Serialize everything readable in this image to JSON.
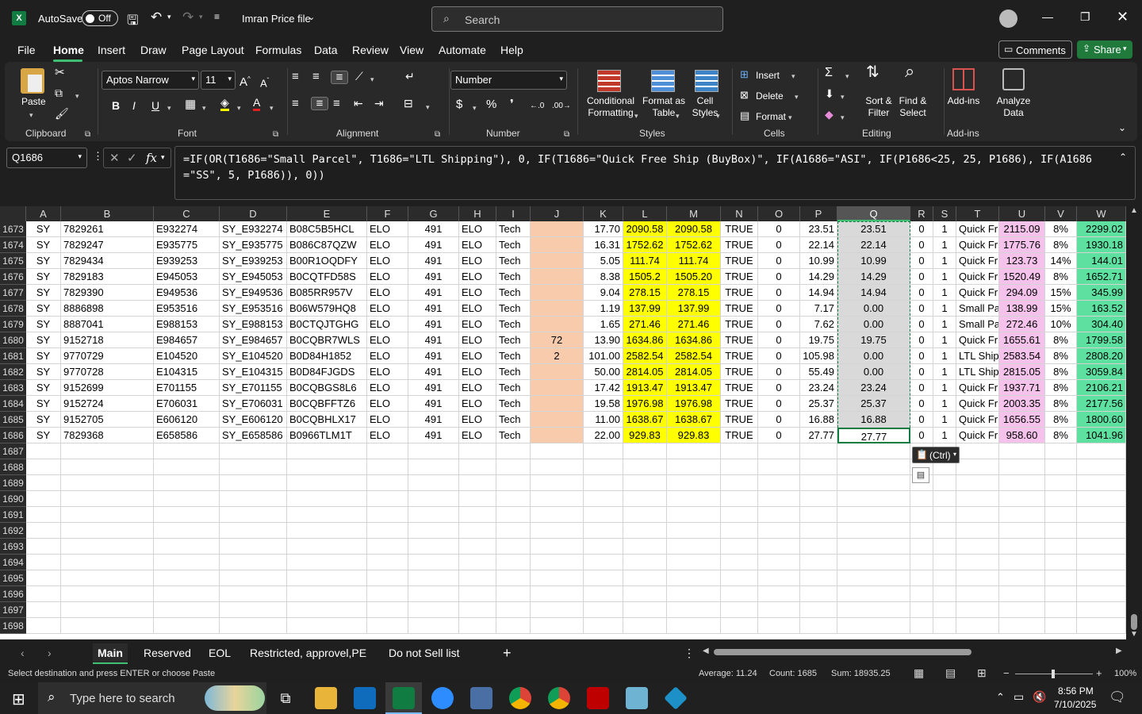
{
  "titlebar": {
    "autosave_label": "AutoSave",
    "autosave_state": "Off",
    "file_name": "Imran Price file",
    "search_placeholder": "Search"
  },
  "menu": [
    "File",
    "Home",
    "Insert",
    "Draw",
    "Page Layout",
    "Formulas",
    "Data",
    "Review",
    "View",
    "Automate",
    "Help"
  ],
  "comments_label": "Comments",
  "share_label": "Share",
  "ribbon": {
    "paste": "Paste",
    "clipboard": "Clipboard",
    "font_name": "Aptos Narrow",
    "font_size": "11",
    "font": "Font",
    "alignment": "Alignment",
    "number_format": "Number",
    "number": "Number",
    "cond_fmt": "Conditional Formatting",
    "fmt_table": "Format as Table",
    "cell_styles": "Cell Styles",
    "styles": "Styles",
    "insert": "Insert",
    "delete": "Delete",
    "format": "Format",
    "cells": "Cells",
    "sort_filter": "Sort & Filter",
    "find_select": "Find & Select",
    "editing": "Editing",
    "addins": "Add-ins",
    "analyze": "Analyze Data",
    "addins_grp": "Add-ins"
  },
  "namebox": "Q1686",
  "formula": "=IF(OR(T1686=\"Small Parcel\", T1686=\"LTL Shipping\"), 0, IF(T1686=\"Quick Free Ship (BuyBox)\", IF(A1686=\"ASI\", IF(P1686<25, 25, P1686), IF(A1686=\"SS\", 5, P1686)), 0))",
  "columns": [
    "A",
    "B",
    "C",
    "D",
    "E",
    "F",
    "G",
    "H",
    "I",
    "J",
    "K",
    "L",
    "M",
    "N",
    "O",
    "P",
    "Q",
    "R",
    "S",
    "T",
    "U",
    "V",
    "W"
  ],
  "rows": [
    {
      "n": "1673",
      "c": [
        "SY",
        "7829261",
        "E932274",
        "SY_E932274",
        "B08C5B5HCL",
        "ELO",
        "491",
        "ELO",
        "Tech",
        "",
        "17.70",
        "2090.58",
        "2090.58",
        "TRUE",
        "0",
        "23.51",
        "23.51",
        "0",
        "1",
        "Quick Fr",
        "2115.09",
        "8%",
        "2299.02"
      ]
    },
    {
      "n": "1674",
      "c": [
        "SY",
        "7829247",
        "E935775",
        "SY_E935775",
        "B086C87QZW",
        "ELO",
        "491",
        "ELO",
        "Tech",
        "",
        "16.31",
        "1752.62",
        "1752.62",
        "TRUE",
        "0",
        "22.14",
        "22.14",
        "0",
        "1",
        "Quick Fr",
        "1775.76",
        "8%",
        "1930.18"
      ]
    },
    {
      "n": "1675",
      "c": [
        "SY",
        "7829434",
        "E939253",
        "SY_E939253",
        "B00R1OQDFY",
        "ELO",
        "491",
        "ELO",
        "Tech",
        "",
        "5.05",
        "111.74",
        "111.74",
        "TRUE",
        "0",
        "10.99",
        "10.99",
        "0",
        "1",
        "Quick Fr",
        "123.73",
        "14%",
        "144.01"
      ]
    },
    {
      "n": "1676",
      "c": [
        "SY",
        "7829183",
        "E945053",
        "SY_E945053",
        "B0CQTFD58S",
        "ELO",
        "491",
        "ELO",
        "Tech",
        "",
        "8.38",
        "1505.2",
        "1505.20",
        "TRUE",
        "0",
        "14.29",
        "14.29",
        "0",
        "1",
        "Quick Fr",
        "1520.49",
        "8%",
        "1652.71"
      ]
    },
    {
      "n": "1677",
      "c": [
        "SY",
        "7829390",
        "E949536",
        "SY_E949536",
        "B085RR957V",
        "ELO",
        "491",
        "ELO",
        "Tech",
        "",
        "9.04",
        "278.15",
        "278.15",
        "TRUE",
        "0",
        "14.94",
        "14.94",
        "0",
        "1",
        "Quick Fr",
        "294.09",
        "15%",
        "345.99"
      ]
    },
    {
      "n": "1678",
      "c": [
        "SY",
        "8886898",
        "E953516",
        "SY_E953516",
        "B06W579HQ8",
        "ELO",
        "491",
        "ELO",
        "Tech",
        "",
        "1.19",
        "137.99",
        "137.99",
        "TRUE",
        "0",
        "7.17",
        "0.00",
        "0",
        "1",
        "Small Pa",
        "138.99",
        "15%",
        "163.52"
      ]
    },
    {
      "n": "1679",
      "c": [
        "SY",
        "8887041",
        "E988153",
        "SY_E988153",
        "B0CTQJTGHG",
        "ELO",
        "491",
        "ELO",
        "Tech",
        "",
        "1.65",
        "271.46",
        "271.46",
        "TRUE",
        "0",
        "7.62",
        "0.00",
        "0",
        "1",
        "Small Pa",
        "272.46",
        "10%",
        "304.40"
      ]
    },
    {
      "n": "1680",
      "c": [
        "SY",
        "9152718",
        "E984657",
        "SY_E984657",
        "B0CQBR7WLS",
        "ELO",
        "491",
        "ELO",
        "Tech",
        "72",
        "13.90",
        "1634.86",
        "1634.86",
        "TRUE",
        "0",
        "19.75",
        "19.75",
        "0",
        "1",
        "Quick Fr",
        "1655.61",
        "8%",
        "1799.58"
      ]
    },
    {
      "n": "1681",
      "c": [
        "SY",
        "9770729",
        "E104520",
        "SY_E104520",
        "B0D84H1852",
        "ELO",
        "491",
        "ELO",
        "Tech",
        "2",
        "101.00",
        "2582.54",
        "2582.54",
        "TRUE",
        "0",
        "105.98",
        "0.00",
        "0",
        "1",
        "LTL Shipp",
        "2583.54",
        "8%",
        "2808.20"
      ]
    },
    {
      "n": "1682",
      "c": [
        "SY",
        "9770728",
        "E104315",
        "SY_E104315",
        "B0D84FJGDS",
        "ELO",
        "491",
        "ELO",
        "Tech",
        "",
        "50.00",
        "2814.05",
        "2814.05",
        "TRUE",
        "0",
        "55.49",
        "0.00",
        "0",
        "1",
        "LTL Shipp",
        "2815.05",
        "8%",
        "3059.84"
      ]
    },
    {
      "n": "1683",
      "c": [
        "SY",
        "9152699",
        "E701155",
        "SY_E701155",
        "B0CQBGS8L6",
        "ELO",
        "491",
        "ELO",
        "Tech",
        "",
        "17.42",
        "1913.47",
        "1913.47",
        "TRUE",
        "0",
        "23.24",
        "23.24",
        "0",
        "1",
        "Quick Fr",
        "1937.71",
        "8%",
        "2106.21"
      ]
    },
    {
      "n": "1684",
      "c": [
        "SY",
        "9152724",
        "E706031",
        "SY_E706031",
        "B0CQBFFTZ6",
        "ELO",
        "491",
        "ELO",
        "Tech",
        "",
        "19.58",
        "1976.98",
        "1976.98",
        "TRUE",
        "0",
        "25.37",
        "25.37",
        "0",
        "1",
        "Quick Fr",
        "2003.35",
        "8%",
        "2177.56"
      ]
    },
    {
      "n": "1685",
      "c": [
        "SY",
        "9152705",
        "E606120",
        "SY_E606120",
        "B0CQBHLX17",
        "ELO",
        "491",
        "ELO",
        "Tech",
        "",
        "11.00",
        "1638.67",
        "1638.67",
        "TRUE",
        "0",
        "16.88",
        "16.88",
        "0",
        "1",
        "Quick Fr",
        "1656.55",
        "8%",
        "1800.60"
      ]
    },
    {
      "n": "1686",
      "c": [
        "SY",
        "7829368",
        "E658586",
        "SY_E658586",
        "B0966TLM1T",
        "ELO",
        "491",
        "ELO",
        "Tech",
        "",
        "22.00",
        "929.83",
        "929.83",
        "TRUE",
        "0",
        "27.77",
        "27.77",
        "0",
        "1",
        "Quick Fr",
        "958.60",
        "8%",
        "1041.96"
      ]
    }
  ],
  "empty_rows": [
    "1687",
    "1688",
    "1689",
    "1690",
    "1691",
    "1692",
    "1693",
    "1694",
    "1695",
    "1696",
    "1697",
    "1698"
  ],
  "paste_ctrl": "(Ctrl)",
  "sheets": [
    "Main",
    "Reserved",
    "EOL",
    "Restricted, approvel,PE",
    "Do not Sell list"
  ],
  "status": {
    "message": "Select destination and press ENTER or choose Paste",
    "average": "Average: 11.24",
    "count": "Count: 1685",
    "sum": "Sum: 18935.25",
    "zoom": "100%"
  },
  "taskbar": {
    "search": "Type here to search",
    "time": "8:56 PM",
    "date": "7/10/2025"
  },
  "colors": {
    "j_fill": "#f8cbad",
    "yellow": "#ffff00",
    "pink": "#f4c2ea",
    "green": "#5de0a0",
    "sel_gray": "#d9d9d9",
    "share": "#1f7a3c",
    "excel": "#107c41"
  }
}
